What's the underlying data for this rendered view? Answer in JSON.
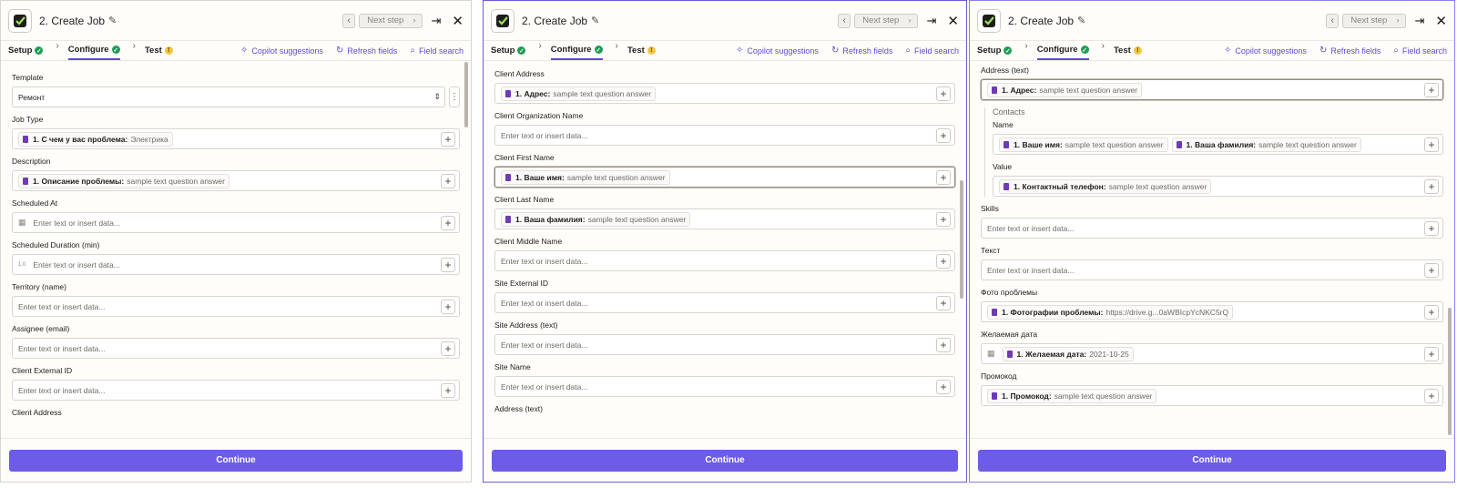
{
  "header": {
    "title": "2. Create Job",
    "next_step": "Next step"
  },
  "tabs": {
    "setup": "Setup",
    "configure": "Configure",
    "test": "Test"
  },
  "tools": {
    "copilot": "Copilot suggestions",
    "refresh": "Refresh fields",
    "search": "Field search"
  },
  "continue_label": "Continue",
  "placeholder": "Enter text or insert data...",
  "panel1": {
    "template_label": "Template",
    "template_value": "Ремонт",
    "job_type_label": "Job Type",
    "job_type_key": "1. С чем у вас проблема:",
    "job_type_val": "Электрика",
    "description_label": "Description",
    "description_key": "1. Описание проблемы:",
    "description_val": "sample text question answer",
    "scheduled_at_label": "Scheduled At",
    "scheduled_duration_label": "Scheduled Duration (min)",
    "duration_prefix": "1.0",
    "territory_label": "Territory (name)",
    "assignee_label": "Assignee (email)",
    "client_external_id_label": "Client External ID",
    "client_address_label": "Client Address"
  },
  "panel2": {
    "client_address_label": "Client Address",
    "client_address_key": "1. Адрес:",
    "client_address_val": "sample text question answer",
    "client_org_label": "Client Organization Name",
    "client_first_label": "Client First Name",
    "client_first_key": "1. Ваше имя:",
    "client_first_val": "sample text question answer",
    "client_last_label": "Client Last Name",
    "client_last_key": "1. Ваша фамилия:",
    "client_last_val": "sample text question answer",
    "client_middle_label": "Client Middle Name",
    "site_external_label": "Site External ID",
    "site_address_label": "Site Address (text)",
    "site_name_label": "Site Name",
    "address_text_label": "Address (text)"
  },
  "panel3": {
    "address_text_label": "Address (text)",
    "address_key": "1. Адрес:",
    "address_val": "sample text question answer",
    "contacts_title": "Contacts",
    "name_label": "Name",
    "name_key1": "1. Ваше имя:",
    "name_val1": "sample text question answer",
    "name_key2": "1. Ваша фамилия:",
    "name_val2": "sample text question answer",
    "value_label": "Value",
    "value_key": "1. Контактный телефон:",
    "value_val": "sample text question answer",
    "skills_label": "Skills",
    "text_label": "Текст",
    "photo_label": "Фото проблемы",
    "photo_key": "1. Фотографии проблемы:",
    "photo_val": "https://drive.g...0aWBIcpYcNKC5rQ",
    "date_label": "Желаемая дата",
    "date_key": "1. Желаемая дата:",
    "date_val": "2021-10-25",
    "promo_label": "Промокод",
    "promo_key": "1. Промокод:",
    "promo_val": "sample text question answer"
  }
}
